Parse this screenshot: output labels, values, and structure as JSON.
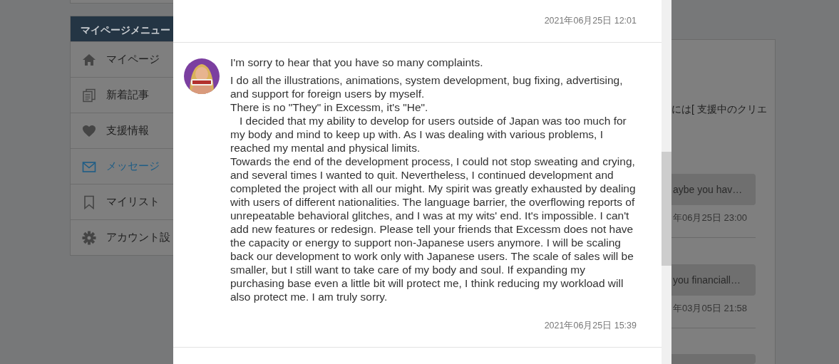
{
  "sidebar": {
    "title": "マイページメニュー",
    "items": [
      {
        "label": "マイページ",
        "kind": "home",
        "selected": false
      },
      {
        "label": "新着記事",
        "kind": "documents",
        "selected": false
      },
      {
        "label": "支援情報",
        "kind": "heart",
        "selected": false
      },
      {
        "label": "メッセージ",
        "kind": "mail",
        "selected": true
      },
      {
        "label": "マイリスト",
        "kind": "bookmark",
        "selected": false
      },
      {
        "label": "アカウント設",
        "kind": "gear",
        "selected": false
      }
    ]
  },
  "background_panel": {
    "notice_text": "には[",
    "notice_link": "支援中のクリエ",
    "threads": [
      {
        "preview": "aybe you hav…",
        "time": "年06月25日 23:00"
      },
      {
        "preview": "you financiall…",
        "time": "年03月05日 21:58"
      }
    ]
  },
  "modal": {
    "messages": [
      {
        "avatar": false,
        "time": "2021年06月25日 12:01"
      },
      {
        "avatar": true,
        "paragraphs": [
          "I'm sorry to hear that you have so many complaints.",
          "I do all the illustrations, animations, system development, bug fixing, advertising, and support for foreign users by myself.\nThere is no \"They\" in Excessm, it's \"He\".\n   I decided that my ability to develop for users outside of Japan was too much for my body and mind to keep up with. As I was dealing with various problems, I reached my mental and physical limits.\nTowards the end of the development process, I could not stop sweating and crying, and several times I wanted to quit. Nevertheless, I continued development and completed the project with all our might. My spirit was greatly exhausted by dealing with users of different nationalities. The language barrier, the overflowing reports of unrepeatable behavioral glitches, and I was at my wits' end. It's impossible. I can't add new features or redesign. Please tell your friends that Excessm does not have the capacity or energy to support non-Japanese users anymore. I will be scaling back our development to work only with Japanese users. The scale of sales will be smaller, but I still want to take care of my body and soul. If expanding my purchasing base even a little bit will protect me, I think reducing my workload will also protect me. I am truly sorry."
        ],
        "time": "2021年06月25日 15:39"
      }
    ]
  }
}
